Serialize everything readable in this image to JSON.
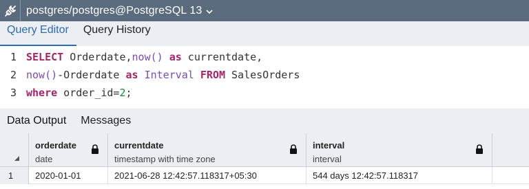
{
  "connection": {
    "title": "postgres/postgres@PostgreSQL 13",
    "icon": "plug-disconnect-icon",
    "chevron": "⌄"
  },
  "editor_tabs": [
    {
      "label": "Query Editor",
      "active": true
    },
    {
      "label": "Query History",
      "active": false
    }
  ],
  "code_lines": [
    {
      "number": "1"
    },
    {
      "number": "2"
    },
    {
      "number": "3"
    }
  ],
  "code": {
    "l1": {
      "kw1": "SELECT",
      "t1": " Orderdate,",
      "fn1": "now()",
      "t2": " ",
      "kw2": "as",
      "t3": " currentdate,"
    },
    "l2": {
      "fn1": "now()",
      "t1": "-Orderdate ",
      "kw1": "as",
      "t2": " ",
      "fn2": "Interval",
      "t3": " ",
      "kw2": "FROM",
      "t4": " SalesOrders"
    },
    "l3": {
      "kw1": "where",
      "t1": " order_id=",
      "num1": "2",
      "t2": ";"
    }
  },
  "result_tabs": [
    {
      "label": "Data Output",
      "active": true
    },
    {
      "label": "Messages",
      "active": false
    }
  ],
  "grid": {
    "columns": [
      {
        "name": "orderdate",
        "type": "date"
      },
      {
        "name": "currentdate",
        "type": "timestamp with time zone"
      },
      {
        "name": "interval",
        "type": "interval"
      }
    ],
    "rows": [
      {
        "num": "1",
        "cells": [
          "2020-01-01",
          "2021-06-28 12:42:57.118317+05:30",
          "544 days 12:42:57.118317"
        ]
      }
    ]
  },
  "colors": {
    "connection_bar": "#5b6b7e",
    "tab_bar": "#ebeef3",
    "active_tab": "#2e6ab0",
    "keyword": "#a8226a",
    "function": "#7a4bb4",
    "number": "#118c2b"
  }
}
